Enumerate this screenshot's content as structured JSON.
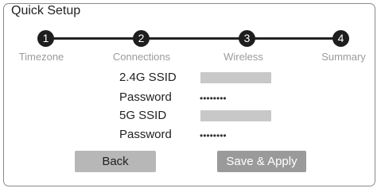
{
  "title": "Quick Setup",
  "steps": [
    {
      "number": "1",
      "label": "Timezone"
    },
    {
      "number": "2",
      "label": "Connections"
    },
    {
      "number": "3",
      "label": "Wireless"
    },
    {
      "number": "4",
      "label": "Summary"
    }
  ],
  "fields": [
    {
      "label": "2.4G SSID",
      "value": ""
    },
    {
      "label": "Password",
      "value": "••••••••"
    },
    {
      "label": "5G SSID",
      "value": ""
    },
    {
      "label": "Password",
      "value": "••••••••"
    }
  ],
  "buttons": {
    "back": "Back",
    "save_apply": "Save & Apply"
  }
}
